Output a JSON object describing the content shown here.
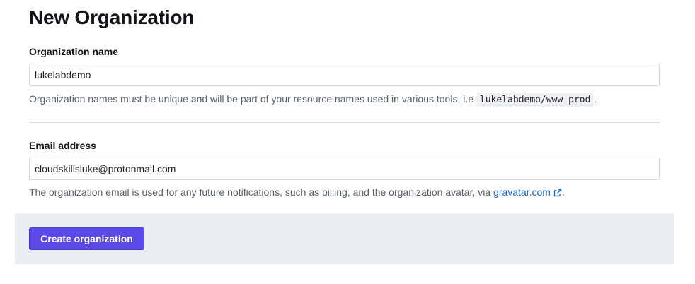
{
  "page": {
    "title": "New Organization"
  },
  "org_name": {
    "label": "Organization name",
    "value": "lukelabdemo",
    "help_text": "Organization names must be unique and will be part of your resource names used in various tools, i.e",
    "example_code": "lukelabdemo/www-prod",
    "help_suffix": "."
  },
  "email": {
    "label": "Email address",
    "value": "cloudskillsluke@protonmail.com",
    "help_text": "The organization email is used for any future notifications, such as billing, and the organization avatar, via",
    "link_text": "gravatar.com",
    "link_icon": "external-link-icon",
    "help_suffix": "."
  },
  "actions": {
    "create_label": "Create organization"
  },
  "colors": {
    "primary_button": "#5b4ae8",
    "link": "#1f6bd6",
    "footer_bg": "#eaedf1"
  }
}
